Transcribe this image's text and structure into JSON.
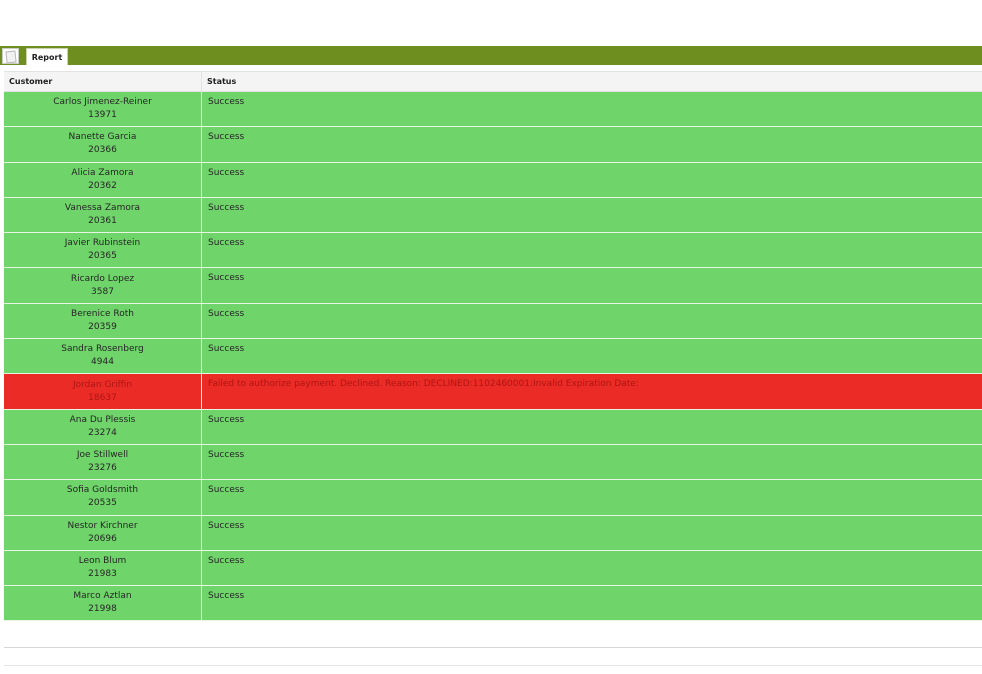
{
  "tab": {
    "label": "Report"
  },
  "table": {
    "headers": {
      "customer": "Customer",
      "status": "Status"
    },
    "rows": [
      {
        "name": "Carlos Jimenez-Reiner",
        "id": "13971",
        "status": "Success",
        "state": "ok"
      },
      {
        "name": "Nanette Garcia",
        "id": "20366",
        "status": "Success",
        "state": "ok"
      },
      {
        "name": "Alicia Zamora",
        "id": "20362",
        "status": "Success",
        "state": "ok"
      },
      {
        "name": "Vanessa Zamora",
        "id": "20361",
        "status": "Success",
        "state": "ok"
      },
      {
        "name": "Javier Rubinstein",
        "id": "20365",
        "status": "Success",
        "state": "ok"
      },
      {
        "name": "Ricardo Lopez",
        "id": "3587",
        "status": "Success",
        "state": "ok"
      },
      {
        "name": "Berenice Roth",
        "id": "20359",
        "status": "Success",
        "state": "ok"
      },
      {
        "name": "Sandra Rosenberg",
        "id": "4944",
        "status": "Success",
        "state": "ok"
      },
      {
        "name": "Jordan Griffin",
        "id": "18637",
        "status": "Failed to authorize payment. Declined. Reason: DECLINED:1102460001:Invalid Expiration Date:",
        "state": "fail"
      },
      {
        "name": "Ana Du Plessis",
        "id": "23274",
        "status": "Success",
        "state": "ok"
      },
      {
        "name": "Joe Stillwell",
        "id": "23276",
        "status": "Success",
        "state": "ok"
      },
      {
        "name": "Sofia Goldsmith",
        "id": "20535",
        "status": "Success",
        "state": "ok"
      },
      {
        "name": "Nestor Kirchner",
        "id": "20696",
        "status": "Success",
        "state": "ok"
      },
      {
        "name": "Leon Blum",
        "id": "21983",
        "status": "Success",
        "state": "ok"
      },
      {
        "name": "Marco Aztlan",
        "id": "21998",
        "status": "Success",
        "state": "ok"
      }
    ]
  },
  "colors": {
    "tabbar": "#6e8e1f",
    "success": "#6fd46a",
    "failure": "#ea2b26"
  },
  "icons": {
    "tab_icon": "page-icon"
  }
}
